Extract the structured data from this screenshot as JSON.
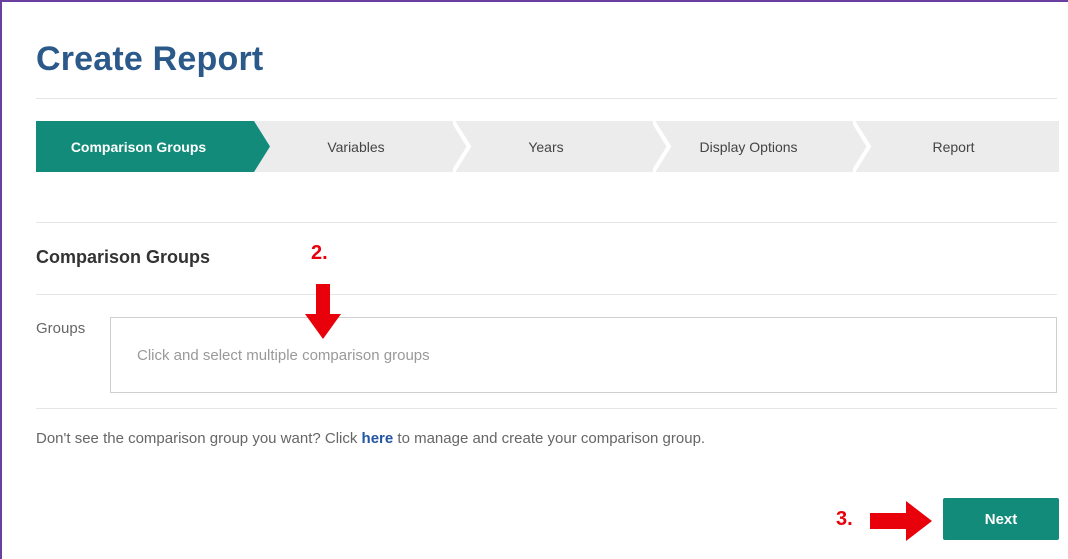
{
  "page": {
    "title": "Create Report"
  },
  "stepper": {
    "steps": [
      {
        "label": "Comparison Groups",
        "active": true
      },
      {
        "label": "Variables",
        "active": false
      },
      {
        "label": "Years",
        "active": false
      },
      {
        "label": "Display Options",
        "active": false
      },
      {
        "label": "Report",
        "active": false
      }
    ]
  },
  "section": {
    "title": "Comparison Groups",
    "groups_label": "Groups",
    "groups_placeholder": "Click and select multiple comparison groups"
  },
  "help": {
    "prefix": "Don't see the comparison group you want? Click ",
    "link_text": "here",
    "suffix": " to manage and create your comparison group."
  },
  "actions": {
    "next_label": "Next"
  },
  "annotations": {
    "step2": "2.",
    "step3": "3."
  },
  "colors": {
    "accent": "#138b7a",
    "title": "#2b5a8a",
    "annotation": "#e8000b",
    "frame": "#6b3fa0"
  }
}
